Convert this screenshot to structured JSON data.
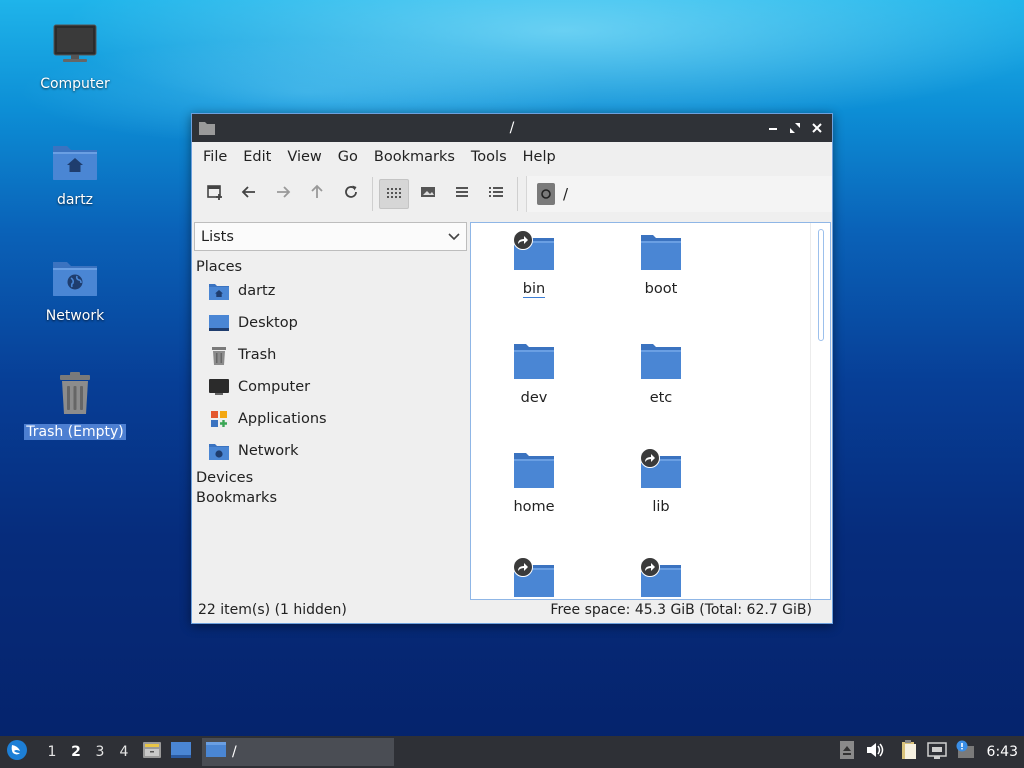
{
  "desktop": {
    "icons": [
      {
        "label": "Computer",
        "icon": "computer-icon"
      },
      {
        "label": "dartz",
        "icon": "home-folder-icon"
      },
      {
        "label": "Network",
        "icon": "network-folder-icon"
      },
      {
        "label": "Trash (Empty)",
        "icon": "trash-icon",
        "selected": true
      }
    ]
  },
  "window": {
    "title": "/",
    "menu": [
      "File",
      "Edit",
      "View",
      "Go",
      "Bookmarks",
      "Tools",
      "Help"
    ],
    "toolbar": {
      "buttons": [
        "new-tab-icon",
        "back-arrow-icon",
        "forward-arrow-icon",
        "up-arrow-icon",
        "reload-icon",
        "icon-view-icon",
        "thumbnail-view-icon",
        "compact-view-icon",
        "detailed-list-icon"
      ],
      "path": "/"
    },
    "sidebar": {
      "mode": "Lists",
      "places_header": "Places",
      "places": [
        "dartz",
        "Desktop",
        "Trash",
        "Computer",
        "Applications",
        "Network"
      ],
      "devices_header": "Devices",
      "bookmarks_header": "Bookmarks"
    },
    "files": [
      {
        "name": "bin",
        "symlink": true
      },
      {
        "name": "boot",
        "symlink": false
      },
      {
        "name": "dev",
        "symlink": false
      },
      {
        "name": "etc",
        "symlink": false
      },
      {
        "name": "home",
        "symlink": false
      },
      {
        "name": "lib",
        "symlink": true
      },
      {
        "name": "",
        "symlink": true
      },
      {
        "name": "",
        "symlink": true
      }
    ],
    "status": {
      "items": "22 item(s) (1 hidden)",
      "space": "Free space: 45.3 GiB (Total: 62.7 GiB)"
    }
  },
  "taskbar": {
    "workspaces": [
      "1",
      "2",
      "3",
      "4"
    ],
    "active_workspace": "2",
    "task_title": "/",
    "clock": "6:43"
  },
  "colors": {
    "folder": "#4a86d4",
    "folder_tab": "#3b73c0",
    "selection": "#4d7fd1",
    "titlebar": "#2f3237",
    "taskbar": "#2e3036"
  }
}
